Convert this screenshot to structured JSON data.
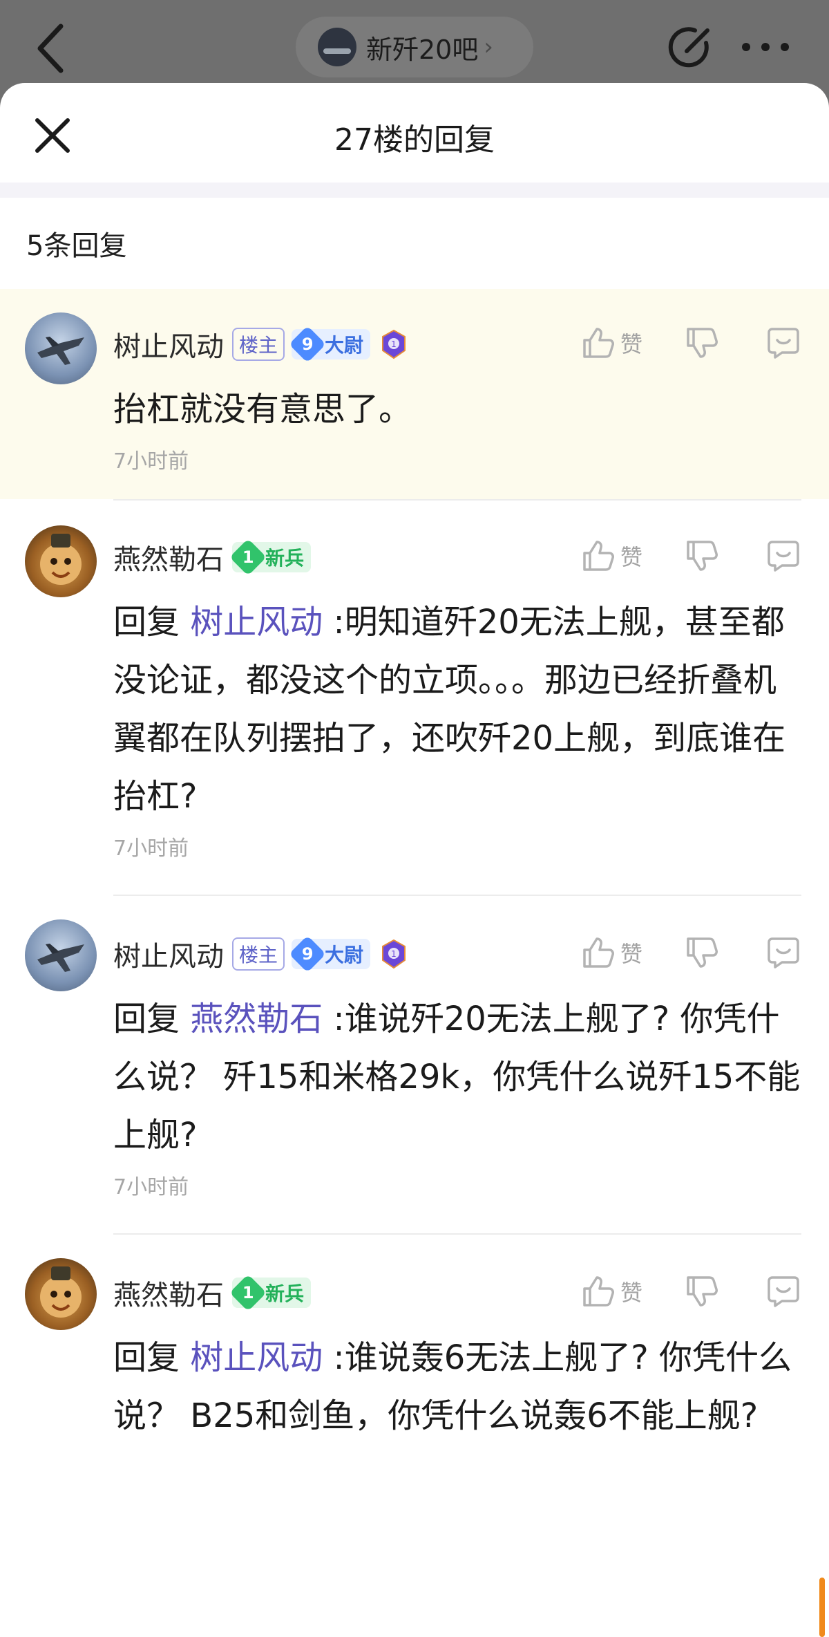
{
  "topbar": {
    "forum_name": "新歼20吧",
    "chevron": "›"
  },
  "sheet": {
    "title": "27楼的回复",
    "reply_count": "5条回复"
  },
  "replies": [
    {
      "username": "树止风动",
      "avatar": "jet-avatar",
      "owner_badge": "楼主",
      "level_num": "9",
      "level_title": "大尉",
      "has_medal": true,
      "like_label": "赞",
      "prefix": "",
      "mention": "",
      "text": "抬杠就没有意思了。",
      "time": "7小时前",
      "highlight": true
    },
    {
      "username": "燕然勒石",
      "avatar": "monkey-avatar",
      "owner_badge": "",
      "level_num": "1",
      "level_title": "新兵",
      "has_medal": false,
      "like_label": "赞",
      "prefix": "回复 ",
      "mention": "树止风动",
      "text": " :明知道歼20无法上舰，甚至都没论证，都没这个的立项。。。那边已经折叠机翼都在队列摆拍了，还吹歼20上舰，到底谁在抬杠?",
      "time": "7小时前",
      "highlight": false
    },
    {
      "username": "树止风动",
      "avatar": "jet-avatar",
      "owner_badge": "楼主",
      "level_num": "9",
      "level_title": "大尉",
      "has_medal": true,
      "like_label": "赞",
      "prefix": "回复 ",
      "mention": "燕然勒石",
      "text": " :谁说歼20无法上舰了? 你凭什么说？ 歼15和米格29k，你凭什么说歼15不能上舰?",
      "time": "7小时前",
      "highlight": false
    },
    {
      "username": "燕然勒石",
      "avatar": "monkey-avatar",
      "owner_badge": "",
      "level_num": "1",
      "level_title": "新兵",
      "has_medal": false,
      "like_label": "赞",
      "prefix": "回复 ",
      "mention": "树止风动",
      "text": " :谁说轰6无法上舰了? 你凭什么说？ B25和剑鱼，你凭什么说轰6不能上舰?",
      "time": "",
      "highlight": false
    }
  ],
  "colors": {
    "accent_mention": "#5a52bd",
    "highlight_bg": "#fdfbed",
    "scroll_thumb": "#f08a1b"
  }
}
